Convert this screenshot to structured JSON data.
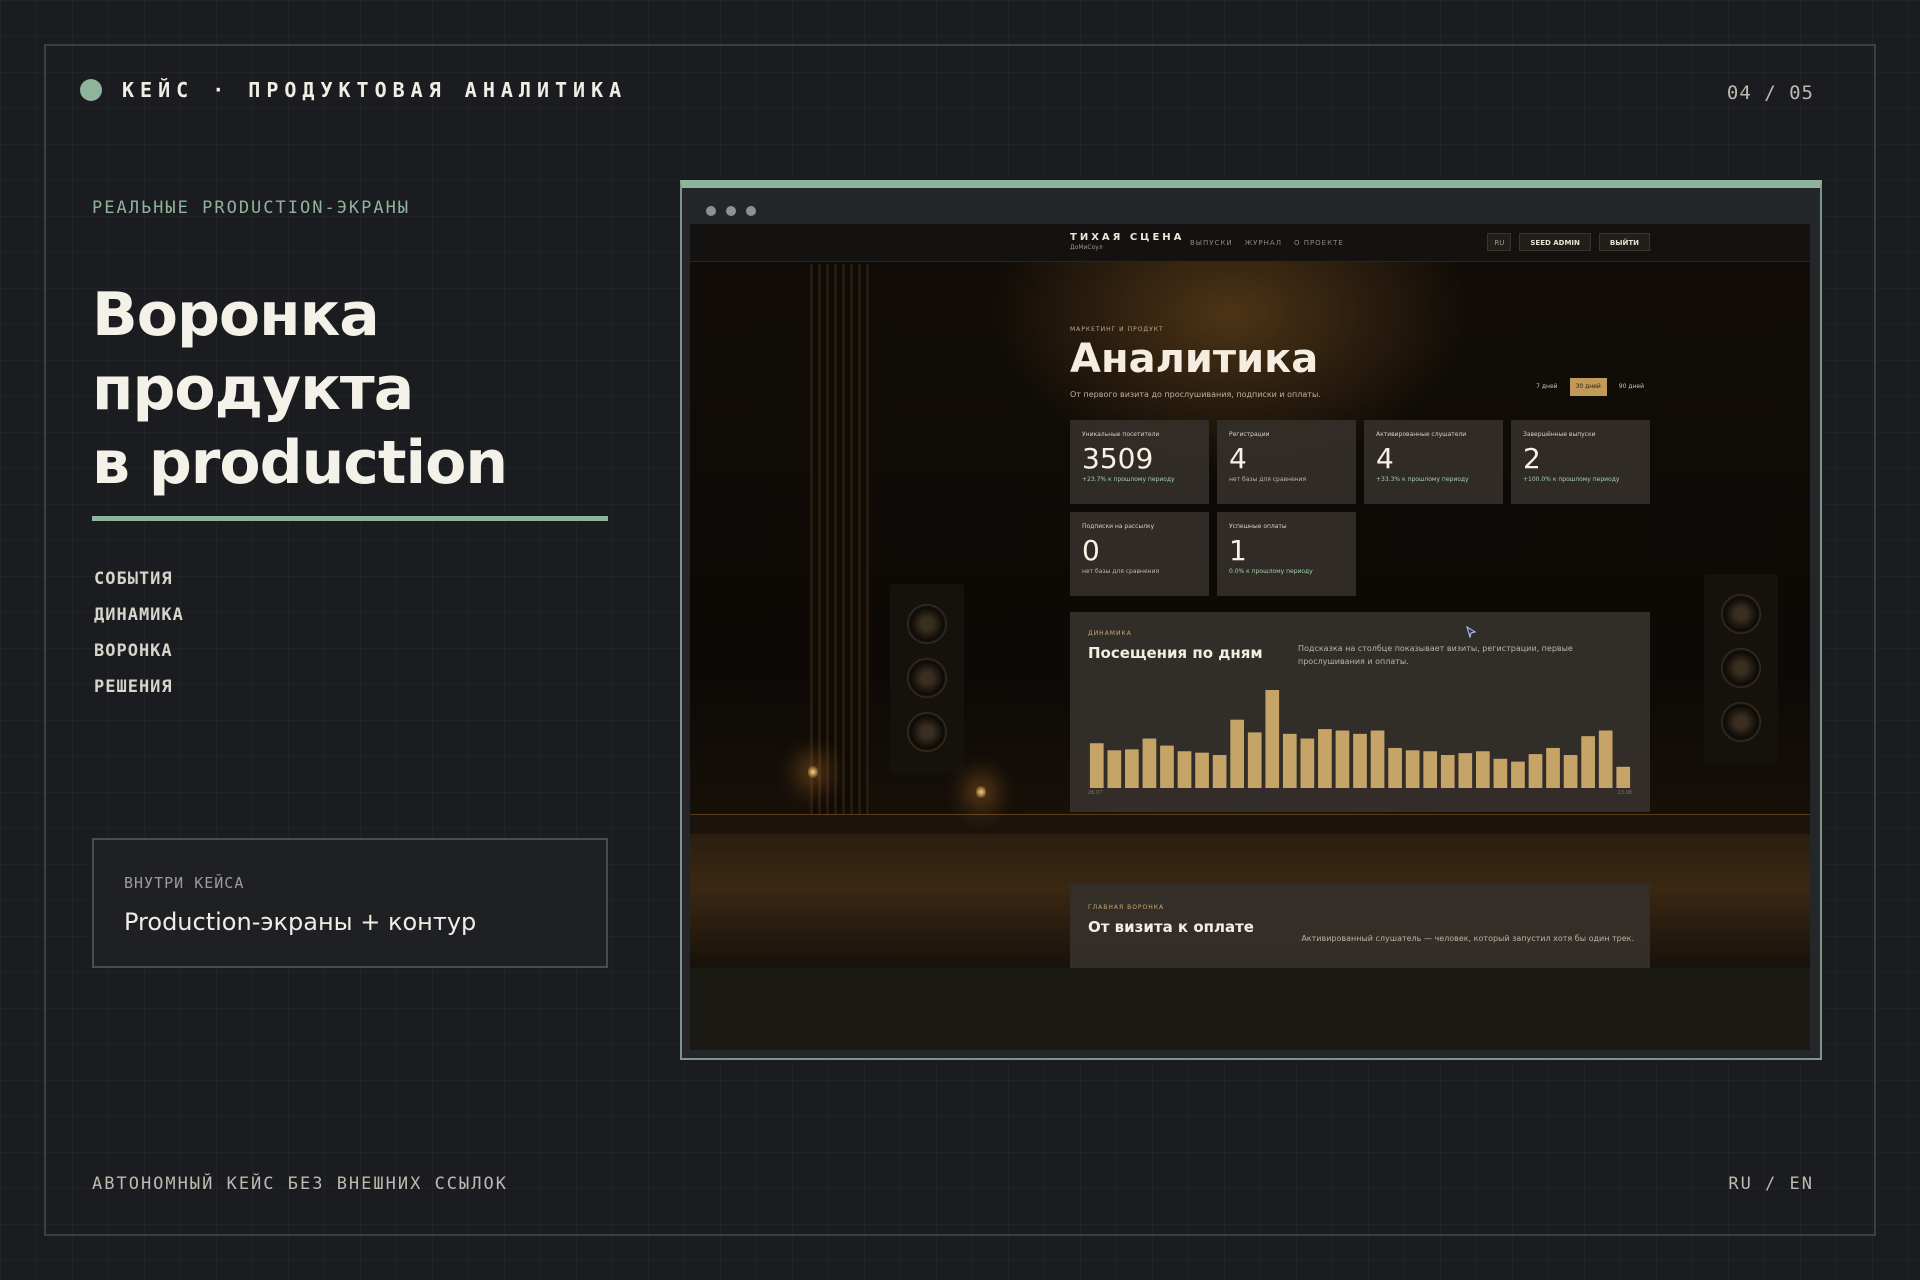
{
  "header": {
    "kicker": "КЕЙС · ПРОДУКТОВАЯ АНАЛИТИКА",
    "counter": "04 / 05"
  },
  "left": {
    "eyebrow": "РЕАЛЬНЫЕ PRODUCTION-ЭКРАНЫ",
    "title_lines": [
      "Воронка",
      "продукта",
      "в production"
    ],
    "nav": [
      "СОБЫТИЯ",
      "ДИНАМИКА",
      "ВОРОНКА",
      "РЕШЕНИЯ"
    ],
    "inside": {
      "label": "ВНУТРИ КЕЙСА",
      "value": "Production-экраны + контур"
    }
  },
  "footer": {
    "left": "АВТОНОМНЫЙ КЕЙС БЕЗ ВНЕШНИХ ССЫЛОК",
    "right": "RU / EN"
  },
  "app": {
    "brand": "ТИХАЯ СЦЕНА",
    "brand_sub": "ДоМиСоул",
    "nav": [
      "ВЫПУСКИ",
      "ЖУРНАЛ",
      "О ПРОЕКТЕ"
    ],
    "lang": "RU",
    "user": "SEED ADMIN",
    "logout": "ВЫЙТИ",
    "eyebrow": "МАРКЕТИНГ И ПРОДУКТ",
    "title": "Аналитика",
    "subtitle": "От первого визита до прослушивания, подписки и оплаты.",
    "periods": [
      {
        "label": "7 дней",
        "active": false
      },
      {
        "label": "30 дней",
        "active": true
      },
      {
        "label": "90 дней",
        "active": false
      }
    ],
    "cards": [
      {
        "label": "Уникальные посетители",
        "value": "3509",
        "delta": "+23.7% к прошлому периоду",
        "positive": true
      },
      {
        "label": "Регистрации",
        "value": "4",
        "delta": "нет базы для сравнения",
        "positive": false
      },
      {
        "label": "Активированные слушатели",
        "value": "4",
        "delta": "+33.3% к прошлому периоду",
        "positive": true
      },
      {
        "label": "Завершённые выпуски",
        "value": "2",
        "delta": "+100.0% к прошлому периоду",
        "positive": true
      },
      {
        "label": "Подписки на рассылку",
        "value": "0",
        "delta": "нет базы для сравнения",
        "positive": false
      },
      {
        "label": "Успешные оплаты",
        "value": "1",
        "delta": "0.0% к прошлому периоду",
        "positive": true
      }
    ],
    "chart": {
      "eyebrow": "ДИНАМИКА",
      "title": "Посещения по дням",
      "hint": "Подсказка на столбце показывает визиты, регистрации, первые прослушивания и оплаты.",
      "x_start": "26.07",
      "x_end": "23.08"
    },
    "funnel": {
      "eyebrow": "ГЛАВНАЯ ВОРОНКА",
      "title": "От визита к оплате",
      "hint": "Активированный слушатель — человек, который запустил хотя бы один трек."
    }
  },
  "chart_data": {
    "type": "bar",
    "title": "Посещения по дням",
    "x_start_label": "26.07",
    "x_end_label": "23.08",
    "values": [
      95,
      80,
      82,
      105,
      90,
      78,
      75,
      70,
      145,
      118,
      208,
      115,
      105,
      125,
      122,
      115,
      122,
      85,
      80,
      78,
      70,
      74,
      78,
      62,
      56,
      72,
      85,
      70,
      110,
      122,
      45
    ],
    "color": "#c6a468",
    "grid": false
  },
  "colors": {
    "accent": "#8fb39b",
    "bar": "#c6a468",
    "period_active": "#c19a5a",
    "positive_delta": "#9fd0a9"
  }
}
